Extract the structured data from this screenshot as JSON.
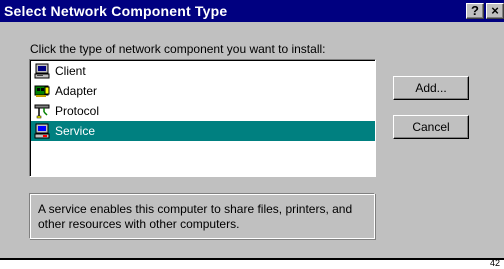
{
  "window": {
    "title": "Select Network Component Type",
    "help_label": "?",
    "close_label": "×"
  },
  "instruction": "Click the type of network component you want to install:",
  "list": {
    "items": [
      {
        "label": "Client",
        "icon": "computer-icon",
        "selected": false
      },
      {
        "label": "Adapter",
        "icon": "network-card-icon",
        "selected": false
      },
      {
        "label": "Protocol",
        "icon": "protocol-cable-icon",
        "selected": false
      },
      {
        "label": "Service",
        "icon": "service-computer-icon",
        "selected": true
      }
    ]
  },
  "buttons": {
    "add_label": "Add...",
    "cancel_label": "Cancel"
  },
  "description": "A service enables this computer to share files, printers, and other resources with other computers.",
  "corner_number": "42",
  "colors": {
    "titlebar": "#000080",
    "face": "#c0c0c0",
    "selection": "#008080"
  }
}
